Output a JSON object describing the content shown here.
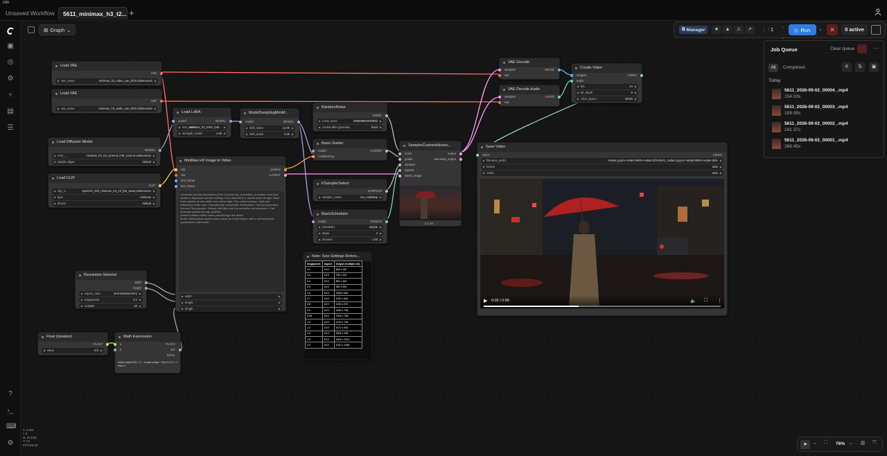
{
  "window_title": "idle",
  "tabs": [
    {
      "label": "Unsaved Workflow"
    },
    {
      "label": "5611_minimax_h3_t2..."
    }
  ],
  "graph_label": "Graph",
  "toolbar": {
    "manager": "Manager",
    "run": "Run",
    "queue_count": "1",
    "active": "0 active"
  },
  "job_queue": {
    "title": "Job Queue",
    "clear": "Clear queue",
    "filter_all": "All",
    "filter_completed": "Completed",
    "today": "Today",
    "jobs": [
      {
        "name": "5611_2026-09-02_00004_.mp4",
        "time": "154.03s"
      },
      {
        "name": "5611_2026-09-02_00003_.mp4",
        "time": "159.09s"
      },
      {
        "name": "5611_2026-09-02_00002_.mp4",
        "time": "241.37s"
      },
      {
        "name": "5611_2026-09-02_00001_.mp4",
        "time": "269.45s"
      }
    ]
  },
  "nodes": {
    "load_vae1": {
      "title": "Load VAE",
      "out": "VAE",
      "w_label": "vae_name",
      "w_value": "minimax_h3_video_vae_bf16.safetensors"
    },
    "load_vae2": {
      "title": "Load VAE",
      "out": "VAE",
      "w_label": "vae_name",
      "w_value": "minimax_h3_audio_vae_bf32.safetensors"
    },
    "load_lora": {
      "title": "Load LoRA",
      "in": "model",
      "out": "MODEL",
      "w1_label": "lora_name",
      "w1_value": "minimax_h3_rel2v_turb...",
      "w2_label": "strength_model",
      "w2_value": "1.00"
    },
    "model_sampling": {
      "title": "ModelSamplingMiniM...",
      "in": "model",
      "out": "MODEL",
      "w1_label": "shift_video",
      "w1_value": "12.00",
      "w2_label": "shift_audio",
      "w2_value": "3.00"
    },
    "random_noise": {
      "title": "RandomNoise",
      "out": "NOISE",
      "w1_label": "noise_seed",
      "w1_value": "590589802030962",
      "w2_label": "control after generate",
      "w2_value": "fixed"
    },
    "basic_guider": {
      "title": "Basic Guider",
      "in1": "model",
      "in2": "conditioning",
      "out": "GUIDER"
    },
    "ksampler_select": {
      "title": "KSamplerSelect",
      "out": "SAMPLER",
      "w_label": "sampler_name",
      "w_value": "res_multistep"
    },
    "basic_scheduler": {
      "title": "BasicScheduler",
      "in": "model",
      "out": "SIGMAS",
      "w1_label": "scheduler",
      "w1_value": "simple",
      "w2_label": "steps",
      "w2_value": "4",
      "w3_label": "denoise",
      "w3_value": "1.00"
    },
    "sampler_custom": {
      "title": "SamplerCustomAdvanc...",
      "ins": [
        "noise",
        "guider",
        "sampler",
        "sigmas",
        "latent_image"
      ],
      "out1": "output",
      "out2": "denoised_output",
      "caption": "2 x 18"
    },
    "load_diffusion": {
      "title": "Load Diffusion Model",
      "out": "MODEL",
      "w1_label": "unet_...",
      "w1_value": "minimax_h3_t2v_pruned_int8_convrot.safetensors",
      "w2_label": "weight_dtype",
      "w2_value": "default"
    },
    "load_clip": {
      "title": "Load CLIP",
      "out": "CLIP",
      "w1_label": "clip_n...",
      "w1_value": "qwen3vl_32b_minimax_h3_mf_fp8_swaq.safetensors",
      "w2_label": "type",
      "w2_value": "minimax",
      "w3_label": "device",
      "w3_value": "default"
    },
    "i2v": {
      "title": "MiniMax H3 Image to Video",
      "ins": [
        "clip",
        "vae",
        "first_frame",
        "last_frame"
      ],
      "out1": "positive",
      "out2": "LATENT",
      "prompt": "Cinematic portrait description [Shot 1] (close-up, cinematic), a medium shot that shows a Japanese woman holding a red umbrella in a rain-lit street at night. Bare feets sneaks as she walks from left to right. The camera tracks. Light and reflections of the road. Following her movement. Reflections. The wet pavement.\nGeneral Soundscape: Steady rain falls onto the umbrella and pavement. Soft footsteps splash through puddles.\nAmbient distant traffic hums past through the street.\nMusic: Melancholic sparse piano notes at a slow tempo with a soft sustained synthesizer underneath.",
      "w1": "width",
      "w2": "height",
      "w3": "length"
    },
    "res_selector": {
      "title": "Resolution Selector",
      "out1": "width",
      "out2": "height",
      "w1_label": "aspect_ratio",
      "w1_value": "16:9 (Widescreen)",
      "w2_label": "megapixels",
      "w2_value": "0.4",
      "w3_label": "multiple",
      "w3_value": "32"
    },
    "float_dur": {
      "title": "Float (duration)",
      "out": "FLOAT",
      "w_label": "value",
      "w_value": "5.0"
    },
    "math_expr": {
      "title": "Math Expression",
      "ins": [
        "a",
        "b"
      ],
      "outs": [
        "FLOAT",
        "INT",
        "BOOL"
      ],
      "expr": "math.ceil(a*25) + 0 - 1math.ceil(a * 24)+1 if 0 < 1 else 0"
    },
    "vae_decode": {
      "title": "VAE Decode",
      "in1": "samples",
      "in2": "vae",
      "out": "IMAGE"
    },
    "vae_decode_audio": {
      "title": "VAE Decode Audio",
      "in1": "samples",
      "in2": "vae",
      "out": "AUDIO"
    },
    "create_video": {
      "title": "Create Video",
      "in1": "images",
      "in2": "audio",
      "out": "VIDEO",
      "w1_label": "fps",
      "w1_value": "24",
      "w2_label": "bit_depth",
      "w2_value": "8",
      "w3_label": "color_space",
      "w3_value": "sRGB"
    },
    "save_video": {
      "title": "Save Video",
      "in": "video",
      "out": "VIDEO",
      "w1_label": "filename_prefix",
      "w1_value": "%date:yyyy%-%date:MM%-%date:dd%/5611_%date:yyyy%-%date:MM%-%date:dd%",
      "w2_label": "format",
      "w2_value": "auto",
      "w3_label": "codec",
      "w3_value": "auto",
      "time": "0:02 / 0:05",
      "progress": 0.4
    }
  },
  "note": {
    "title": "Note: Size Settings Refere...",
    "headers": [
      "megapixels",
      "Aspect",
      "Output (multiple=32)"
    ],
    "rows": [
      [
        "0.2",
        "16:9",
        "608 x 352"
      ],
      [
        "0.3",
        "16:9",
        "736 x 416"
      ],
      [
        "0.4",
        "16:9",
        "864 x 480"
      ],
      [
        "0.5",
        "16:9",
        "960 x 544"
      ],
      [
        "0.6",
        "16:9",
        "1056 x 608"
      ],
      [
        "0.7",
        "16:9",
        "1152 x 640"
      ],
      [
        "0.8",
        "16:9",
        "1216 x 672"
      ],
      [
        "0.9",
        "16:9",
        "1280 x 736"
      ],
      [
        "0.95",
        "16:9",
        "1344 x 768"
      ],
      [
        "1.0",
        "16:9",
        "1376 x 768"
      ],
      [
        "1.2",
        "16:9",
        "1472 x 832"
      ],
      [
        "1.5",
        "16:9",
        "1664 x 928"
      ],
      [
        "1.8",
        "16:9",
        "1824 x 1024"
      ],
      [
        "2.0",
        "16:9",
        "1920 x 1088"
      ]
    ]
  },
  "zoom": "76%",
  "stats": "T: 0.00s\nI: 0\nN: 29 [29]\nV: 51\nFPS:59.88",
  "colors": {
    "model": "#b39ddb",
    "clip": "#ffd54f",
    "vae": "#ff6e6e",
    "latent": "#ff9cf9",
    "image": "#64b5f6",
    "audio": "#7ad7a0",
    "conditioning": "#ffa931",
    "noise": "#bbbbbb",
    "video": "#8fd9a8",
    "float": "#aaee88"
  }
}
